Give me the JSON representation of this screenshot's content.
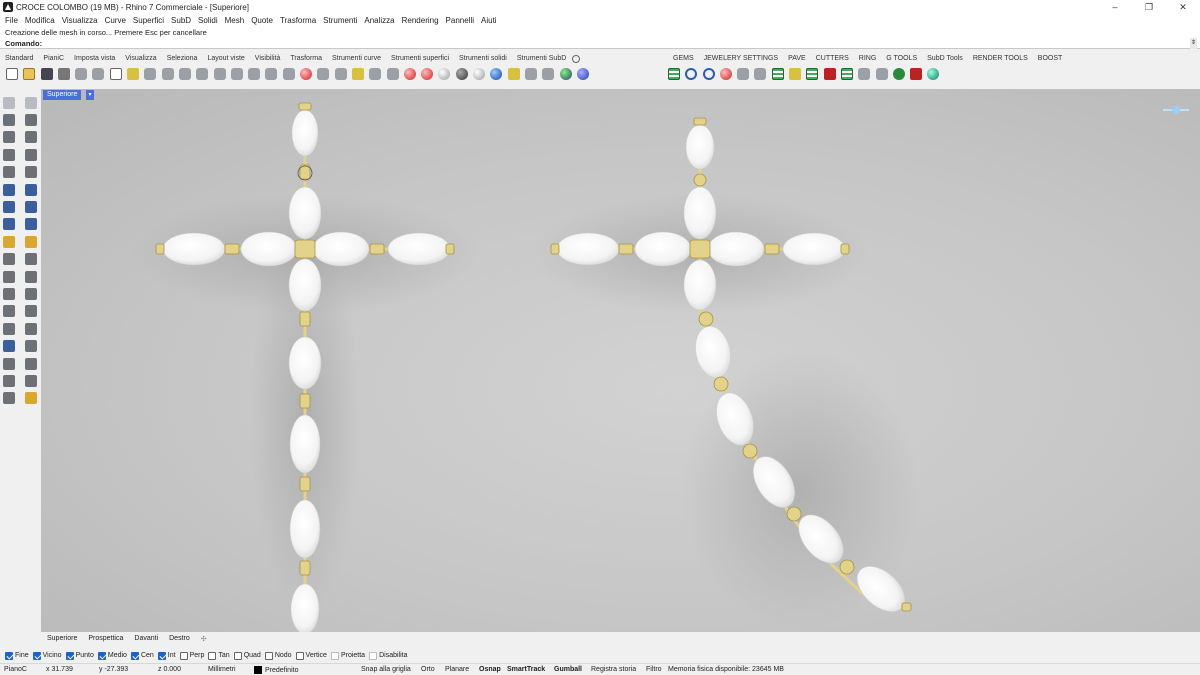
{
  "window": {
    "title": "CROCE COLOMBO (19 MB) - Rhino 7 Commerciale - [Superiore]",
    "controls": {
      "minimize": "–",
      "maximize": "❐",
      "close": "✕"
    }
  },
  "menu": [
    "File",
    "Modifica",
    "Visualizza",
    "Curve",
    "Superfici",
    "SubD",
    "Solidi",
    "Mesh",
    "Quote",
    "Trasforma",
    "Strumenti",
    "Analizza",
    "Rendering",
    "Pannelli",
    "Aiuti"
  ],
  "command": {
    "history": "Creazione delle mesh in corso... Premere Esc per cancellare",
    "prompt": "Comando:",
    "value": ""
  },
  "toolbar_tabs_left": [
    "Standard",
    "PianiC",
    "Imposta vista",
    "Visualizza",
    "Seleziona",
    "Layout viste",
    "Visibilità",
    "Trasforma",
    "Strumenti curve",
    "Strumenti superfici",
    "Strumenti solidi",
    "Strumenti SubD"
  ],
  "toolbar_tabs_right": [
    "GEMS",
    "JEWELERY SETTINGS",
    "PAVE",
    "CUTTERS",
    "RING",
    "G TOOLS",
    "SubD Tools",
    "RENDER TOOLS",
    "BOOST"
  ],
  "viewport": {
    "label": "Superiore",
    "dropdown": "▾"
  },
  "viewport_tabs": [
    "Superiore",
    "Prospettica",
    "Davanti",
    "Destro"
  ],
  "viewport_tabs_add": "✣",
  "osnap": [
    {
      "label": "Fine",
      "checked": true
    },
    {
      "label": "Vicino",
      "checked": true
    },
    {
      "label": "Punto",
      "checked": true
    },
    {
      "label": "Medio",
      "checked": true
    },
    {
      "label": "Cen",
      "checked": true
    },
    {
      "label": "Int",
      "checked": true
    },
    {
      "label": "Perp",
      "checked": false
    },
    {
      "label": "Tan",
      "checked": false
    },
    {
      "label": "Quad",
      "checked": false
    },
    {
      "label": "Nodo",
      "checked": false
    },
    {
      "label": "Vertice",
      "checked": false
    },
    {
      "label": "Proietta",
      "checked": false
    },
    {
      "label": "Disabilita",
      "checked": false
    }
  ],
  "status": {
    "cplane": "PianoC",
    "x": "x 31.739",
    "y": "y -27.393",
    "z": "z 0.000",
    "units": "Millimetri",
    "layer": "Predefinito",
    "snap_grid": "Snap alla griglia",
    "ortho": "Orto",
    "planar": "Planare",
    "osnap": "Osnap",
    "smarttrack": "SmartTrack",
    "gumball": "Gumball",
    "history": "Registra storia",
    "filter": "Filtro",
    "memory": "Memoria fisica disponibile: 23645 MB"
  },
  "colors": {
    "viewport_label_bg": "#4a6fd6",
    "pearl": "#ffffff",
    "gold": "#e3d28a",
    "checkbox_on": "#1d64c8"
  },
  "icons": {
    "standard_toolbar": [
      "new-file-icon",
      "open-folder-icon",
      "save-icon",
      "print-icon",
      "paste-icon",
      "cut-icon",
      "copy-icon",
      "paste-clipboard-icon",
      "undo-icon",
      "pan-hand-icon",
      "move-view-icon",
      "zoom-dynamic-icon",
      "zoom-window-icon",
      "zoom-extents-icon",
      "zoom-selected-icon",
      "rotate-view-icon",
      "four-viewports-icon",
      "cplane-icon",
      "hide-icon",
      "show-icon",
      "select-icon",
      "lock-icon",
      "unlock-icon",
      "layer-icon",
      "color-wheel-icon",
      "render-sphere-icon",
      "shaded-sphere-icon",
      "render-preview-icon",
      "ghosted-sphere-icon",
      "light-icon",
      "dimension-icon",
      "options-icon",
      "plugin-globe-icon",
      "help-icon"
    ],
    "jewelry_toolbar": [
      "gem-grid-icon",
      "ring-icon",
      "gem-target-icon",
      "prong-icon",
      "cutter-icon",
      "bezel-icon",
      "pave-grid-icon",
      "pave-array-icon",
      "setting-icon",
      "gem-map-icon",
      "channel-icon",
      "seat-icon",
      "cabochon-icon",
      "gem-sphere-icon",
      "render-gem-icon",
      "boost-gem-icon"
    ]
  }
}
